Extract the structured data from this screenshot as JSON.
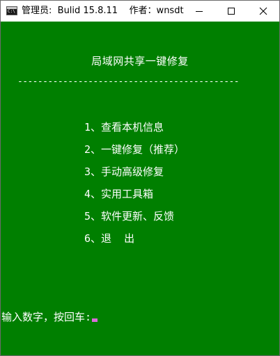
{
  "window": {
    "title": "管理员:  Bulid 15.8.11    作者：wnsdt",
    "icon_text": "C:\\",
    "icon": "console-icon",
    "controls": {
      "minimize_icon": "minimize-icon",
      "maximize_icon": "maximize-icon",
      "close_icon": "close-icon"
    }
  },
  "colors": {
    "console_background": "#007f00",
    "console_text": "#ffffff",
    "cursor": "#d96cd9"
  },
  "console": {
    "header_title": "局域网共享一键修复",
    "divider": "--------------------------------------------",
    "menu": [
      "1、查看本机信息",
      "2、一键修复（推荐）",
      "3、手动高级修复",
      "4、实用工具箱",
      "5、软件更新、反馈",
      "6、退  出"
    ],
    "prompt": "输入数字，按回车:"
  }
}
